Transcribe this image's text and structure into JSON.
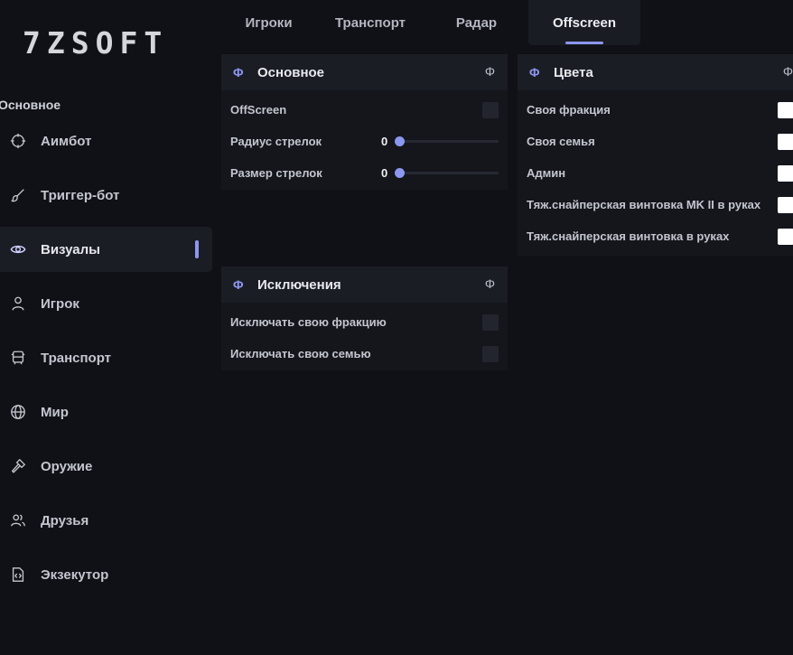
{
  "brand": "7ZSOFT",
  "sidebar": {
    "section_title": "Основное",
    "items": [
      {
        "label": "Аимбот",
        "icon": "crosshair-icon"
      },
      {
        "label": "Триггер-бот",
        "icon": "brush-icon"
      },
      {
        "label": "Визуалы",
        "icon": "eye-icon",
        "active": true
      },
      {
        "label": "Игрок",
        "icon": "user-icon"
      },
      {
        "label": "Транспорт",
        "icon": "bus-icon"
      },
      {
        "label": "Мир",
        "icon": "globe-icon"
      },
      {
        "label": "Оружие",
        "icon": "hammer-icon"
      },
      {
        "label": "Друзья",
        "icon": "users-icon"
      },
      {
        "label": "Экзекутор",
        "icon": "code-file-icon"
      }
    ]
  },
  "tabs": [
    {
      "label": "Игроки"
    },
    {
      "label": "Транспорт"
    },
    {
      "label": "Радар"
    },
    {
      "label": "Offscreen",
      "active": true
    }
  ],
  "panels": {
    "main": {
      "title": "Основное",
      "icon": "Φ",
      "offscreen_label": "OffScreen",
      "offscreen_checked": false,
      "radius_label": "Радиус стрелок",
      "radius_value": "0",
      "radius_fraction": 0,
      "size_label": "Размер стрелок",
      "size_value": "0",
      "size_fraction": 0
    },
    "exceptions": {
      "title": "Исключения",
      "icon": "Φ",
      "items": [
        {
          "label": "Исключать свою фракцию",
          "checked": false
        },
        {
          "label": "Исключать свою семью",
          "checked": false
        }
      ]
    },
    "colors": {
      "title": "Цвета",
      "icon": "Φ",
      "items": [
        {
          "label": "Своя фракция",
          "color": "#ffffff"
        },
        {
          "label": "Своя семья",
          "color": "#ffffff"
        },
        {
          "label": "Админ",
          "color": "#ffffff"
        },
        {
          "label": "Тяж.снайперская винтовка MK II в руках",
          "color": "#ffffff"
        },
        {
          "label": "Тяж.снайперская винтовка в руках",
          "color": "#ffffff"
        }
      ]
    }
  },
  "colors": {
    "accent": "#8c97f0",
    "background": "#101116",
    "panel": "#14161c",
    "panel_header": "#1b1d25"
  }
}
